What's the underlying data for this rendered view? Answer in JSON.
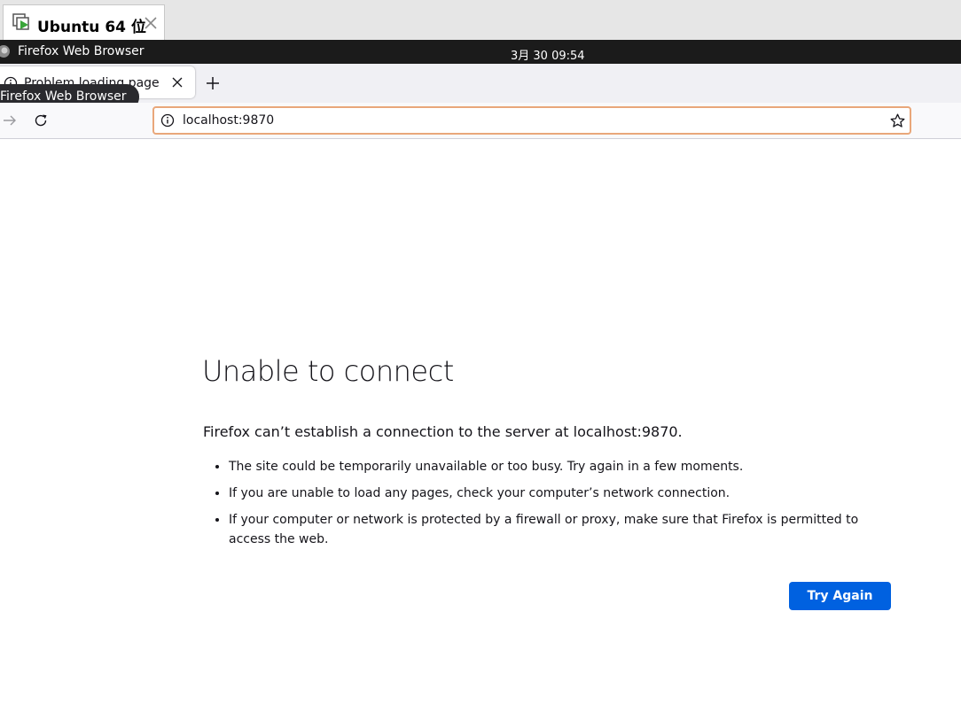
{
  "vm": {
    "tab_label": "Ubuntu 64 位"
  },
  "topbar": {
    "app_name": "Firefox Web Browser",
    "clock": "3月 30  09:54"
  },
  "browser": {
    "tab_title": "Problem loading page",
    "tooltip": "Firefox Web Browser",
    "url": "localhost:9870"
  },
  "error_page": {
    "title": "Unable to connect",
    "lead": "Firefox can’t establish a connection to the server at localhost:9870.",
    "bullets": [
      "The site could be temporarily unavailable or too busy. Try again in a few moments.",
      "If you are unable to load any pages, check your computer’s network connection.",
      "If your computer or network is protected by a firewall or proxy, make sure that Firefox is permitted to access the web."
    ],
    "button_label": "Try Again"
  },
  "colors": {
    "accent": "#0061e0",
    "topbar": "#1b1b1b",
    "urlbar_focus": "#e9a77a"
  }
}
